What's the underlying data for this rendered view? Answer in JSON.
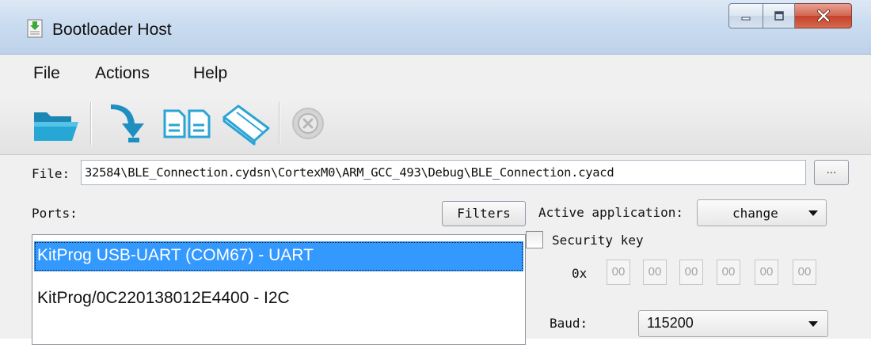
{
  "window": {
    "title": "Bootloader Host",
    "accent_color": "#3399ff",
    "titlebar_color": "#cadcf0"
  },
  "menu": {
    "items": [
      {
        "label": "File"
      },
      {
        "label": "Actions"
      },
      {
        "label": "Help"
      }
    ]
  },
  "toolbar": {
    "buttons": [
      {
        "icon": "open-folder-icon"
      },
      {
        "icon": "program-download-icon"
      },
      {
        "icon": "verify-files-icon"
      },
      {
        "icon": "erase-eraser-icon"
      },
      {
        "icon": "stop-cancel-icon",
        "enabled": false
      }
    ]
  },
  "file": {
    "label": "File:",
    "path": "32584\\BLE_Connection.cydsn\\CortexM0\\ARM_GCC_493\\Debug\\BLE_Connection.cyacd",
    "browse_label": "..."
  },
  "ports": {
    "label": "Ports:",
    "filters_label": "Filters",
    "items": [
      {
        "label": "KitProg USB-UART (COM67) - UART",
        "selected": true
      },
      {
        "label": "KitProg/0C220138012E4400 - I2C",
        "selected": false
      }
    ]
  },
  "active_application": {
    "label": "Active application:",
    "value": "change"
  },
  "security": {
    "label": "Security key",
    "checked": false,
    "prefix": "0x",
    "bytes": [
      "00",
      "00",
      "00",
      "00",
      "00",
      "00"
    ]
  },
  "baud": {
    "label": "Baud:",
    "value": "115200"
  }
}
